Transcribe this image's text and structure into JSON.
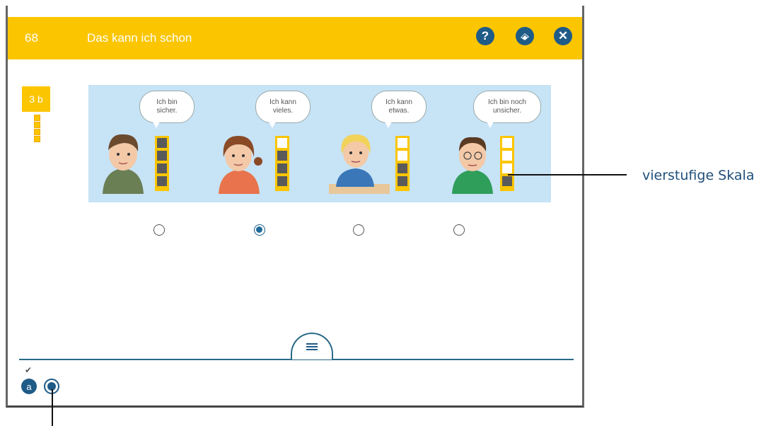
{
  "header": {
    "page_number": "68",
    "title": "Das kann ich schon",
    "buttons": {
      "help": "?",
      "close": "✕"
    }
  },
  "task_badge": "3 b",
  "scale_panel": {
    "items": [
      {
        "line1": "Ich bin",
        "line2": "sicher."
      },
      {
        "line1": "Ich kann",
        "line2": "vieles."
      },
      {
        "line1": "Ich kann",
        "line2": "etwas."
      },
      {
        "line1": "Ich bin noch",
        "line2": "unsicher."
      }
    ],
    "selected_index": 1
  },
  "subtasks": [
    {
      "label": "a",
      "done": true
    },
    {
      "label": "",
      "current": true
    }
  ],
  "annotation": {
    "label": "vierstufige Skala"
  },
  "colors": {
    "accent_yellow": "#fbc500",
    "accent_blue": "#1f5b87",
    "panel_blue": "#c7e3f6"
  }
}
